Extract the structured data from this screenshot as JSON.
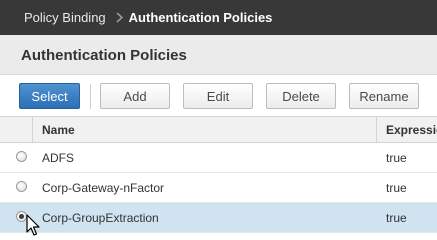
{
  "breadcrumb": {
    "parent": "Policy Binding",
    "current": "Authentication Policies"
  },
  "page": {
    "title": "Authentication Policies"
  },
  "toolbar": {
    "select": "Select",
    "add": "Add",
    "edit": "Edit",
    "delete": "Delete",
    "rename": "Rename"
  },
  "table": {
    "columns": {
      "name": "Name",
      "expression": "Expression"
    },
    "rows": [
      {
        "name": "ADFS",
        "expression": "true",
        "selected": false
      },
      {
        "name": "Corp-Gateway-nFactor",
        "expression": "true",
        "selected": false
      },
      {
        "name": "Corp-GroupExtraction",
        "expression": "true",
        "selected": true
      }
    ]
  },
  "colors": {
    "topbar": "#383838",
    "primary_button": "#2d6fb4",
    "selected_row": "#cfe3f0"
  },
  "icons": [
    "chevron-right-icon",
    "radio-icon",
    "mouse-pointer-icon"
  ]
}
